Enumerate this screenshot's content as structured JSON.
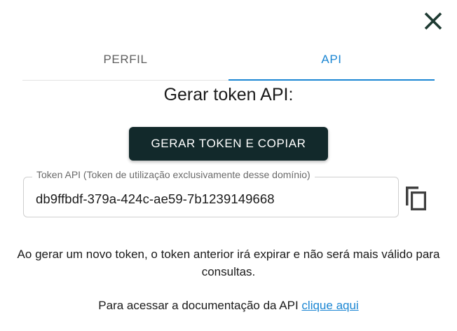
{
  "close": {
    "icon": "close-icon",
    "color": "#1e3a32"
  },
  "tabs": [
    {
      "label": "PERFIL",
      "active": false
    },
    {
      "label": "API",
      "active": true
    }
  ],
  "accent_color": "#1b86d3",
  "section": {
    "title": "Gerar token API:"
  },
  "generate_button": {
    "label": "GERAR TOKEN E COPIAR",
    "background": "#12292b"
  },
  "token_field": {
    "label": "Token API (Token de utilização exclusivamente desse domínio)",
    "value": "db9ffbdf-379a-424c-ae59-7b1239149668"
  },
  "copy_button": {
    "icon": "copy-icon"
  },
  "warning": {
    "text": "Ao gerar um novo token, o token anterior irá expirar e não será mais válido para consultas."
  },
  "docs": {
    "text": "Para acessar a documentação da API",
    "link_label": "clique aqui"
  }
}
